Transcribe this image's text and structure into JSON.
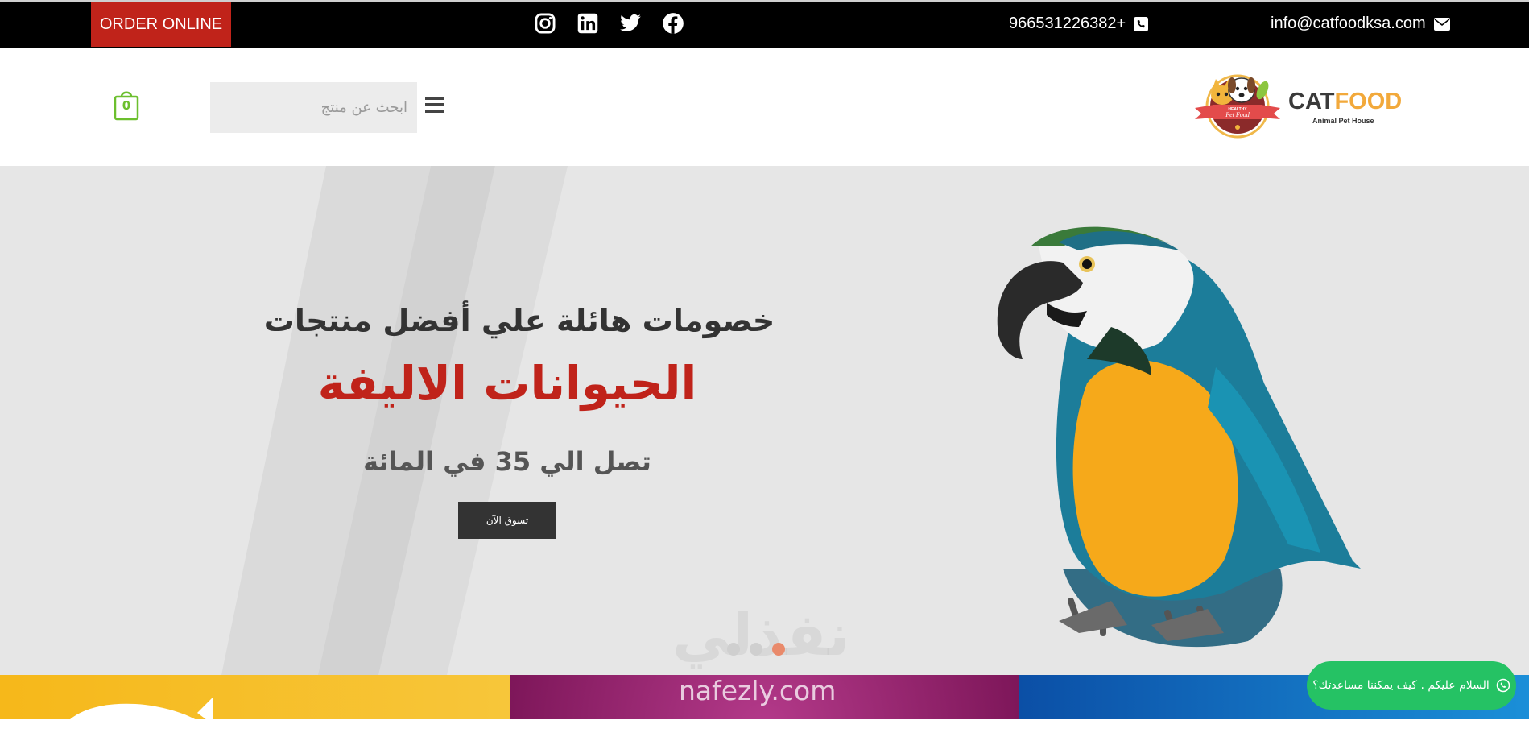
{
  "topbar": {
    "order_label": "ORDER ONLINE",
    "phone": "966531226382+",
    "email": "info@catfoodksa.com",
    "social_icons": [
      "instagram-icon",
      "linkedin-icon",
      "twitter-icon",
      "facebook-icon"
    ]
  },
  "header": {
    "cart_count": "0",
    "search_placeholder": "ابحث عن منتج",
    "logo_main_1": "CAT",
    "logo_main_2": "FOOD",
    "logo_sub": "Animal Pet House",
    "logo_badge_1": "HEALTHY",
    "logo_badge_2": "Pet Food"
  },
  "hero": {
    "line1": "خصومات هائلة علي أفضل منتجات",
    "line2": "الحيوانات الاليفة",
    "line3": "تصل الي 35 في المائة",
    "button": "تسوق الآن",
    "slides": 3,
    "active_slide": 3
  },
  "watermark": {
    "arabic": "نفذلي",
    "latin": "nafezly.com"
  },
  "whatsapp": {
    "label": "السلام عليكم . كيف يمكننا مساعدتك؟"
  },
  "colors": {
    "accent_red": "#c0231a",
    "cart_green": "#6cbf2e",
    "whatsapp_green": "#25c264"
  }
}
